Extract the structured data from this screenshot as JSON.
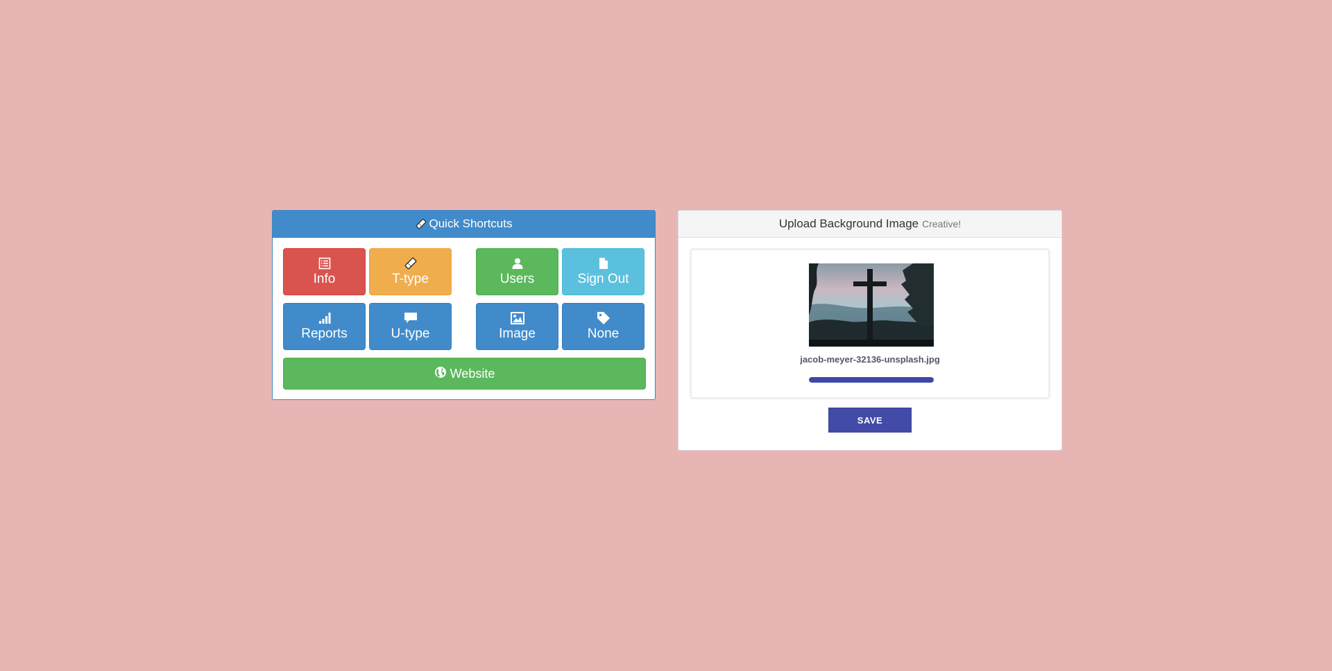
{
  "shortcuts_panel": {
    "title": "Quick Shortcuts",
    "title_icon": "ticket-icon",
    "tiles": [
      {
        "label": "Info",
        "icon": "list-icon",
        "color": "#d9534f"
      },
      {
        "label": "T-type",
        "icon": "ticket-icon",
        "color": "#f0ad4e"
      },
      {
        "label": "Users",
        "icon": "user-icon",
        "color": "#5cb85c"
      },
      {
        "label": "Sign Out",
        "icon": "file-icon",
        "color": "#5bc0de"
      },
      {
        "label": "Reports",
        "icon": "signal-icon",
        "color": "#428bca"
      },
      {
        "label": "U-type",
        "icon": "comment-icon",
        "color": "#428bca"
      },
      {
        "label": "Image",
        "icon": "picture-icon",
        "color": "#428bca"
      },
      {
        "label": "None",
        "icon": "tag-icon",
        "color": "#428bca"
      }
    ],
    "website": {
      "label": "Website",
      "icon": "globe-icon",
      "color": "#5cb85c"
    }
  },
  "upload_panel": {
    "title": "Upload Background Image",
    "subtitle": "Creative!",
    "file_name": "jacob-meyer-32136-unsplash.jpg",
    "progress": 1.0,
    "progress_color": "#3f48a8",
    "save_label": "SAVE",
    "save_color": "#434ba8"
  },
  "page": {
    "background_color": "#e8b5b5"
  }
}
